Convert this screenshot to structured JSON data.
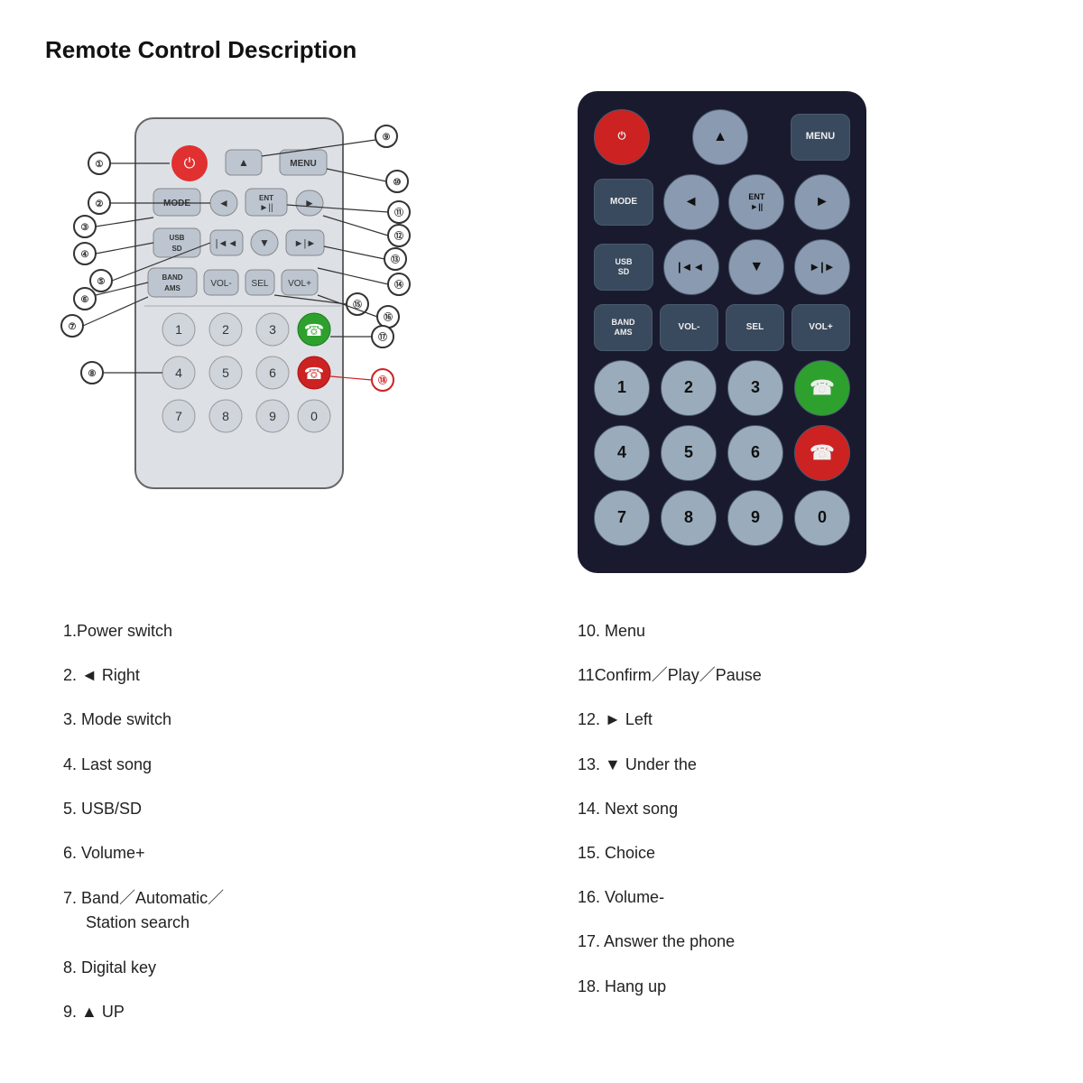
{
  "title": "Remote Control Description",
  "diagram": {
    "rows": [
      [
        "POWER",
        "▲",
        "MENU"
      ],
      [
        "MODE",
        "◄",
        "ENT ►",
        "►"
      ],
      [
        "USB/SD",
        "|◄◄",
        "▼",
        "►|►"
      ],
      [
        "BAND AMS",
        "VOL-",
        "SEL",
        "VOL+"
      ],
      [
        "1",
        "2",
        "3",
        "✆"
      ],
      [
        "4",
        "5",
        "6",
        "✆end"
      ],
      [
        "7",
        "8",
        "9",
        "0"
      ]
    ]
  },
  "callouts": [
    {
      "n": "①",
      "label": "1"
    },
    {
      "n": "②",
      "label": "2"
    },
    {
      "n": "③",
      "label": "3"
    },
    {
      "n": "④",
      "label": "4"
    },
    {
      "n": "⑤",
      "label": "5"
    },
    {
      "n": "⑥",
      "label": "6"
    },
    {
      "n": "⑦",
      "label": "7"
    },
    {
      "n": "⑧",
      "label": "8"
    },
    {
      "n": "⑨",
      "label": "9"
    },
    {
      "n": "⑩",
      "label": "10"
    },
    {
      "n": "⑪",
      "label": "11"
    },
    {
      "n": "⑫",
      "label": "12"
    },
    {
      "n": "⑬",
      "label": "13"
    },
    {
      "n": "⑭",
      "label": "14"
    },
    {
      "n": "⑮",
      "label": "15"
    },
    {
      "n": "⑯",
      "label": "16"
    },
    {
      "n": "⑰",
      "label": "17"
    },
    {
      "n": "⑱",
      "label": "18"
    }
  ],
  "descriptions_left": [
    {
      "num": "1.",
      "text": "Power switch"
    },
    {
      "num": "2. ◄",
      "text": "Right"
    },
    {
      "num": "3.",
      "text": "Mode switch"
    },
    {
      "num": "4.",
      "text": "Last song"
    },
    {
      "num": "5.",
      "text": "USB/SD"
    },
    {
      "num": "6.",
      "text": "Volume+"
    },
    {
      "num": "7.",
      "text": "Band／Automatic／\n      Station search"
    },
    {
      "num": "8.",
      "text": "Digital key"
    },
    {
      "num": "9. ▲",
      "text": "UP"
    }
  ],
  "descriptions_right": [
    {
      "num": "10.",
      "text": "Menu"
    },
    {
      "num": "11",
      "text": "Confirm／Play／Pause"
    },
    {
      "num": "12. ►",
      "text": "Left"
    },
    {
      "num": "13. ▼",
      "text": "Under the"
    },
    {
      "num": "14.",
      "text": "Next song"
    },
    {
      "num": "15.",
      "text": "Choice"
    },
    {
      "num": "16.",
      "text": "Volume-"
    },
    {
      "num": "17.",
      "text": "Answer the phone"
    },
    {
      "num": "18.",
      "text": "Hang up"
    }
  ],
  "remote": {
    "rows": [
      [
        {
          "label": "⏻",
          "class": "power"
        },
        {
          "label": "▲",
          "class": "round"
        },
        {
          "label": "MENU",
          "class": "rb"
        }
      ],
      [
        {
          "label": "MODE",
          "class": "rb mode"
        },
        {
          "label": "◄",
          "class": "round"
        },
        {
          "label": "ENT\n►||",
          "class": "round"
        },
        {
          "label": "►",
          "class": "round"
        }
      ],
      [
        {
          "label": "USB\nSD",
          "class": "rb usbsd"
        },
        {
          "label": "|◄◄",
          "class": "round"
        },
        {
          "label": "▼",
          "class": "round"
        },
        {
          "label": "►|►",
          "class": "round"
        }
      ],
      [
        {
          "label": "BAND\nAMS",
          "class": "rb band"
        },
        {
          "label": "VOL-",
          "class": "rb text-sm"
        },
        {
          "label": "SEL",
          "class": "rb text-sm"
        },
        {
          "label": "VOL+",
          "class": "rb text-sm"
        }
      ],
      [
        {
          "label": "1",
          "class": "num"
        },
        {
          "label": "2",
          "class": "num"
        },
        {
          "label": "3",
          "class": "num"
        },
        {
          "label": "📞",
          "class": "green-call"
        }
      ],
      [
        {
          "label": "4",
          "class": "num"
        },
        {
          "label": "5",
          "class": "num"
        },
        {
          "label": "6",
          "class": "num"
        },
        {
          "label": "📵",
          "class": "red-end"
        }
      ],
      [
        {
          "label": "7",
          "class": "num"
        },
        {
          "label": "8",
          "class": "num"
        },
        {
          "label": "9",
          "class": "num"
        },
        {
          "label": "0",
          "class": "num"
        }
      ]
    ]
  }
}
